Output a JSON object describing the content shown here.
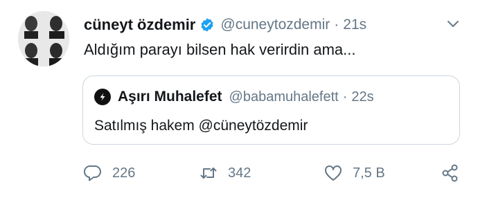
{
  "tweet": {
    "author_name": "cüneyt özdemir",
    "handle": "@cuneytozdemir",
    "separator": "·",
    "time": "21s",
    "text": "Aldığım parayı bilsen hak verirdin ama..."
  },
  "quoted_tweet": {
    "author_name": "Aşırı Muhalefet",
    "handle": "@babamuhalefett",
    "separator": "·",
    "time": "22s",
    "text": "Satılmış hakem @cüneytözdemir"
  },
  "actions": {
    "reply_count": "226",
    "retweet_count": "342",
    "like_count": "7,5 B"
  },
  "icons": {
    "verified": "verified-badge-icon",
    "menu": "chevron-down-icon",
    "reply": "reply-icon",
    "retweet": "retweet-icon",
    "like": "heart-icon",
    "share": "share-icon"
  },
  "colors": {
    "verified": "#1da1f2",
    "text": "#14171a",
    "muted": "#657786",
    "border": "#ccd6dd"
  }
}
